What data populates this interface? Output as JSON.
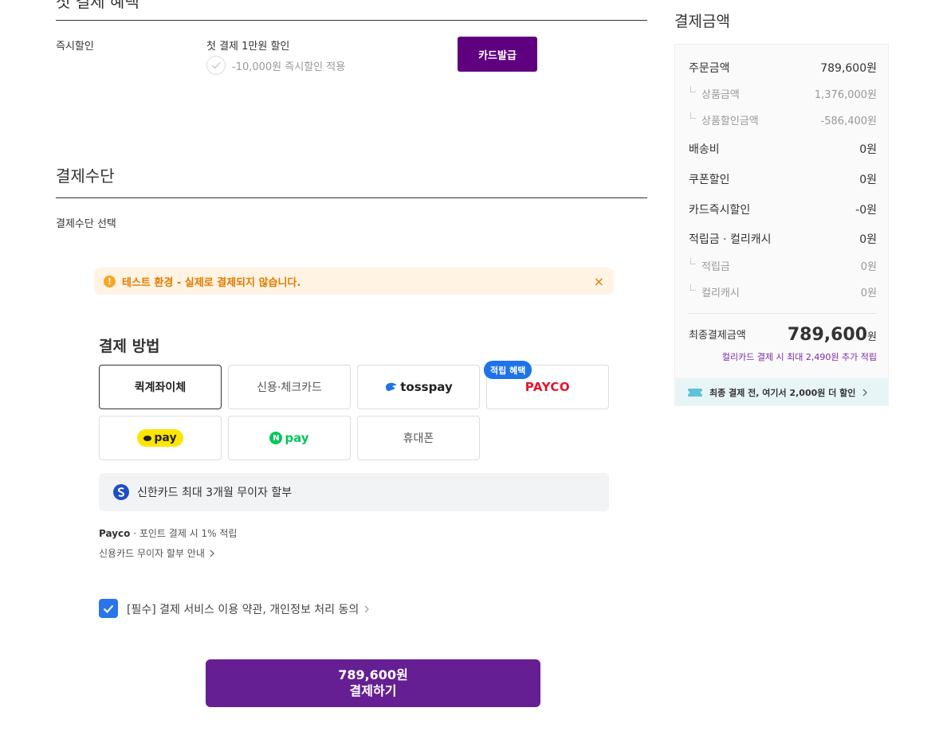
{
  "top_section": {
    "title_cropped": "첫 결제 혜택",
    "instant_discount_label": "즉시할인",
    "discount_name": "첫 결제 1만원 할인",
    "discount_applied": "-10,000원 즉시할인 적용",
    "issue_card_button": "카드발급"
  },
  "payment_method_section": {
    "title": "결제수단",
    "select_label": "결제수단 선택"
  },
  "test_banner": {
    "text": "테스트 환경 - 실제로 결제되지 않습니다.",
    "close": "×"
  },
  "payment": {
    "title": "결제 방법",
    "options": [
      {
        "label": "퀵계좌이체",
        "selected": true
      },
      {
        "label": "신용·체크카드",
        "selected": false
      },
      {
        "label": "tosspay",
        "selected": false
      },
      {
        "label": "PAYCO",
        "selected": false
      },
      {
        "label": "pay",
        "selected": false
      },
      {
        "label": "pay",
        "selected": false
      },
      {
        "label": "휴대폰",
        "selected": false
      }
    ],
    "benefit_badge": "적립 혜택",
    "promo_text": "신한카드 최대 3개월 무이자 할부",
    "note_payco_brand": "Payco",
    "note_payco_text": "· 포인트 결제 시 1% 적립",
    "note_shinhan": "신용카드 무이자 할부 안내",
    "agree_text": "[필수] 결제 서비스 이용 약관, 개인정보 처리 동의",
    "pay_amount": "789,600원",
    "pay_label": "결제하기"
  },
  "summary": {
    "title": "결제금액",
    "rows": [
      {
        "label": "주문금액",
        "value": "789,600원"
      },
      {
        "label": "상품금액",
        "value": "1,376,000원"
      },
      {
        "label": "상품할인금액",
        "value": "-586,400원"
      },
      {
        "label": "배송비",
        "value": "0원"
      },
      {
        "label": "쿠폰할인",
        "value": "0원"
      },
      {
        "label": "카드즉시할인",
        "value": "-0원"
      },
      {
        "label": "적립금 · 컬리캐시",
        "value": "0원"
      },
      {
        "label": "적립금",
        "value": "0원"
      },
      {
        "label": "컬리캐시",
        "value": "0원"
      }
    ],
    "final_label": "최종결제금액",
    "final_amount": "789,600",
    "final_unit": "원",
    "accrual_note": "컬리카드 결제 시 최대 2,490원 추가 적립",
    "coupon_strip": "최종 결제 전, 여기서 2,000원 더 할인"
  },
  "colors": {
    "brand_purple": "#5f0080",
    "pay_button": "#651f92",
    "check_blue": "#2a76e9",
    "payco_red": "#e5152a",
    "naver_green": "#03c75a",
    "kakao_yellow": "#fee500"
  }
}
